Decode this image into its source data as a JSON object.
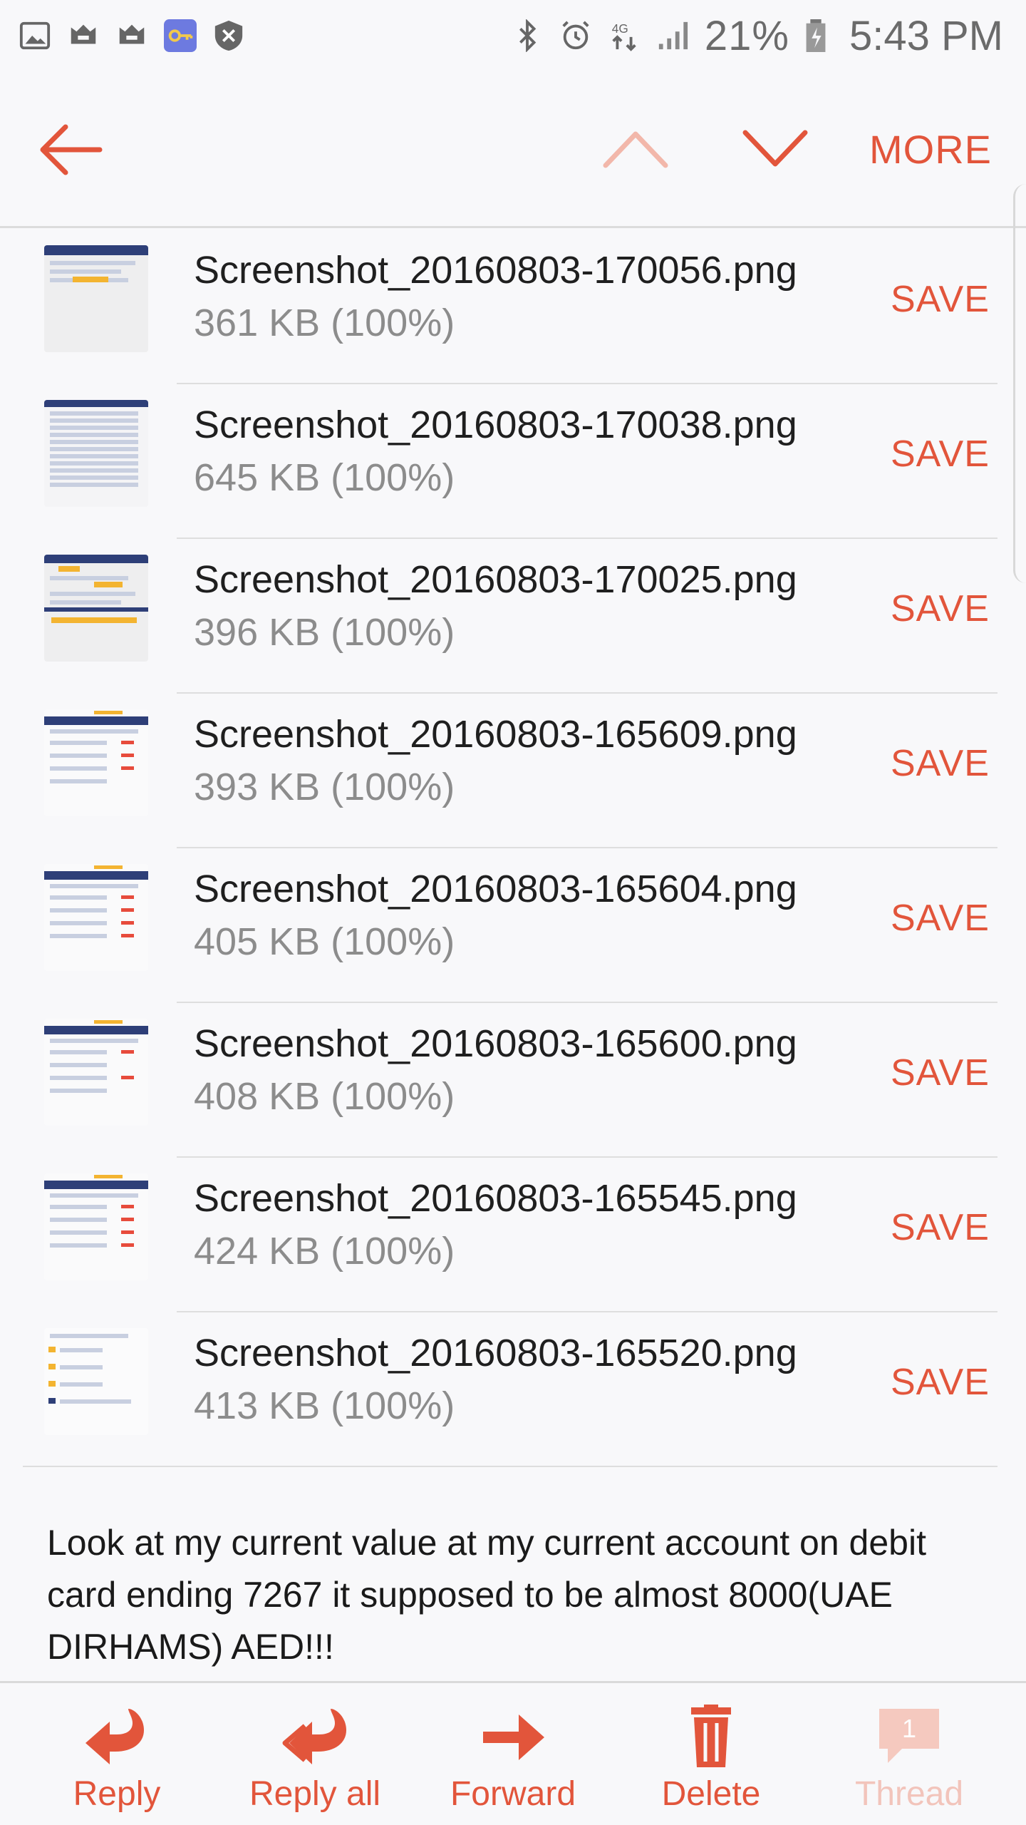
{
  "status_bar": {
    "battery": "21%",
    "time": "5:43 PM",
    "network": "4G",
    "left_icons": [
      "gallery-icon",
      "game-icon",
      "game-icon",
      "key-icon",
      "shield-icon"
    ],
    "right_icons": [
      "bluetooth-icon",
      "alarm-icon",
      "network-arrows-icon",
      "signal-icon",
      "battery-icon"
    ]
  },
  "top_bar": {
    "more_label": "MORE",
    "accent_color": "#e2553b"
  },
  "attachments": [
    {
      "name": "Screenshot_20160803-170056.png",
      "size": "361 KB (100%)",
      "save_label": "SAVE"
    },
    {
      "name": "Screenshot_20160803-170038.png",
      "size": "645 KB (100%)",
      "save_label": "SAVE"
    },
    {
      "name": "Screenshot_20160803-170025.png",
      "size": "396 KB (100%)",
      "save_label": "SAVE"
    },
    {
      "name": "Screenshot_20160803-165609.png",
      "size": "393 KB (100%)",
      "save_label": "SAVE"
    },
    {
      "name": "Screenshot_20160803-165604.png",
      "size": "405 KB (100%)",
      "save_label": "SAVE"
    },
    {
      "name": "Screenshot_20160803-165600.png",
      "size": "408 KB (100%)",
      "save_label": "SAVE"
    },
    {
      "name": "Screenshot_20160803-165545.png",
      "size": "424 KB (100%)",
      "save_label": "SAVE"
    },
    {
      "name": "Screenshot_20160803-165520.png",
      "size": "413 KB (100%)",
      "save_label": "SAVE"
    }
  ],
  "message": {
    "body": "Look at my current value at my current account on debit card ending 7267 it supposed to be almost 8000(UAE DIRHAMS) AED!!!"
  },
  "toolbar": {
    "reply_label": "Reply",
    "reply_all_label": "Reply all",
    "forward_label": "Forward",
    "delete_label": "Delete",
    "thread_label": "Thread",
    "thread_count": "1"
  }
}
